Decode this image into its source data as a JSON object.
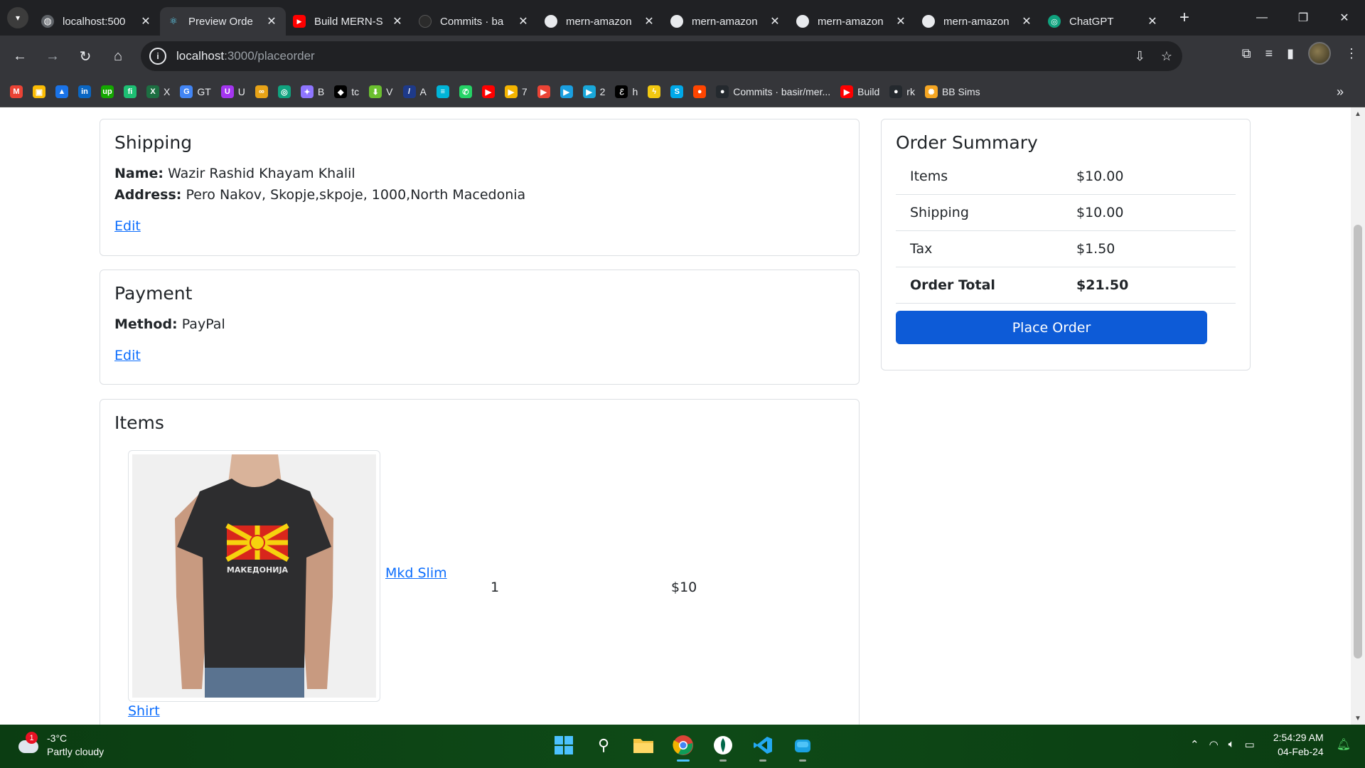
{
  "browser": {
    "tabs": [
      {
        "title": "localhost:500",
        "icon": "globe-icon",
        "active": false
      },
      {
        "title": "Preview Orde",
        "icon": "react-icon",
        "active": true
      },
      {
        "title": "Build MERN-S",
        "icon": "youtube-icon",
        "active": false
      },
      {
        "title": "Commits · ba",
        "icon": "github-icon",
        "active": false
      },
      {
        "title": "mern-amazon",
        "icon": "github-icon",
        "active": false
      },
      {
        "title": "mern-amazon",
        "icon": "github-icon",
        "active": false
      },
      {
        "title": "mern-amazon",
        "icon": "github-icon",
        "active": false
      },
      {
        "title": "mern-amazon",
        "icon": "github-icon",
        "active": false
      },
      {
        "title": "ChatGPT",
        "icon": "chatgpt-icon",
        "active": false
      }
    ],
    "url_host": "localhost",
    "url_rest": ":3000/placeorder",
    "bookmarks": [
      {
        "label": "",
        "icon": "gmail-icon",
        "color": "#ea4335",
        "glyph": "M"
      },
      {
        "label": "",
        "icon": "photos-icon",
        "color": "#fbbc04",
        "glyph": "▣"
      },
      {
        "label": "",
        "icon": "drive-icon",
        "color": "#1a73e8",
        "glyph": "▲"
      },
      {
        "label": "",
        "icon": "linkedin-icon",
        "color": "#0a66c2",
        "glyph": "in"
      },
      {
        "label": "",
        "icon": "upwork-icon",
        "color": "#14a800",
        "glyph": "up"
      },
      {
        "label": "",
        "icon": "fiverr-icon",
        "color": "#1dbf73",
        "glyph": "fi"
      },
      {
        "label": "X",
        "icon": "excel-icon",
        "color": "#1d6f42",
        "glyph": "X"
      },
      {
        "label": "GT",
        "icon": "google-translate-icon",
        "color": "#4285f4",
        "glyph": "G"
      },
      {
        "label": "U",
        "icon": "udemy-icon",
        "color": "#a435f0",
        "glyph": "U"
      },
      {
        "label": "",
        "icon": "coursera-icon",
        "color": "#e8a317",
        "glyph": "∞"
      },
      {
        "label": "",
        "icon": "chatgpt-icon",
        "color": "#10a37f",
        "glyph": "◎"
      },
      {
        "label": "B",
        "icon": "gemini-icon",
        "color": "#8e75ff",
        "glyph": "✦"
      },
      {
        "label": "tc",
        "icon": "tc-icon",
        "color": "#000000",
        "glyph": "◆"
      },
      {
        "label": "V",
        "icon": "download-icon",
        "color": "#6bbf2f",
        "glyph": "⬇"
      },
      {
        "label": "A",
        "icon": "a-icon",
        "color": "#1e3a8a",
        "glyph": "/"
      },
      {
        "label": "",
        "icon": "bar-icon",
        "color": "#00b4d8",
        "glyph": "≡"
      },
      {
        "label": "",
        "icon": "whatsapp-icon",
        "color": "#25d366",
        "glyph": "✆"
      },
      {
        "label": "",
        "icon": "youtube-icon",
        "color": "#ff0000",
        "glyph": "▶"
      },
      {
        "label": "7",
        "icon": "video-icon",
        "color": "#f4b400",
        "glyph": "▶"
      },
      {
        "label": "",
        "icon": "play-red-icon",
        "color": "#ea4335",
        "glyph": "▶"
      },
      {
        "label": "",
        "icon": "play-blue-icon",
        "color": "#1a9fe0",
        "glyph": "▶"
      },
      {
        "label": "2",
        "icon": "play-cyan-icon",
        "color": "#19a7d9",
        "glyph": "▶"
      },
      {
        "label": "h",
        "icon": "e-icon",
        "color": "#000000",
        "glyph": "ℰ"
      },
      {
        "label": "",
        "icon": "bolt-icon",
        "color": "#f2c811",
        "glyph": "ϟ"
      },
      {
        "label": "",
        "icon": "s-icon",
        "color": "#00a8e8",
        "glyph": "S"
      },
      {
        "label": "",
        "icon": "reddit-icon",
        "color": "#ff4500",
        "glyph": "●"
      },
      {
        "label": "Commits · basir/mer...",
        "icon": "github-icon",
        "color": "#24292e",
        "glyph": "●"
      },
      {
        "label": "Build",
        "icon": "youtube-icon",
        "color": "#ff0000",
        "glyph": "▶"
      },
      {
        "label": "rk",
        "icon": "github-icon",
        "color": "#24292e",
        "glyph": "●"
      },
      {
        "label": "BB Sims",
        "icon": "sun-icon",
        "color": "#f5a623",
        "glyph": "✺"
      }
    ]
  },
  "shipping": {
    "title": "Shipping",
    "name_label": "Name:",
    "name_value": "Wazir Rashid Khayam Khalil",
    "address_label": "Address:",
    "address_value": "Pero Nakov, Skopje,skpoje, 1000,North Macedonia",
    "edit_label": "Edit"
  },
  "payment": {
    "title": "Payment",
    "method_label": "Method:",
    "method_value": "PayPal",
    "edit_label": "Edit"
  },
  "items": {
    "title": "Items",
    "list": [
      {
        "name": "Mkd Slim Shirt",
        "name_line1": "Mkd Slim",
        "name_line2": "Shirt",
        "quantity": "1",
        "price": "$10",
        "shirt_text": "МАКЕДОНИЈА"
      }
    ]
  },
  "summary": {
    "title": "Order Summary",
    "rows": [
      {
        "label": "Items",
        "value": "$10.00"
      },
      {
        "label": "Shipping",
        "value": "$10.00"
      },
      {
        "label": "Tax",
        "value": "$1.50"
      },
      {
        "label": "Order Total",
        "value": "$21.50"
      }
    ],
    "button_label": "Place Order"
  },
  "taskbar": {
    "weather_temp": "-3°C",
    "weather_desc": "Partly cloudy",
    "weather_badge": "1",
    "time": "2:54:29 AM",
    "date": "04-Feb-24"
  },
  "colors": {
    "primary": "#0d5bd7",
    "link": "#0d6efd",
    "browser_dark": "#202124",
    "taskbar_green": "#0e4a17"
  }
}
